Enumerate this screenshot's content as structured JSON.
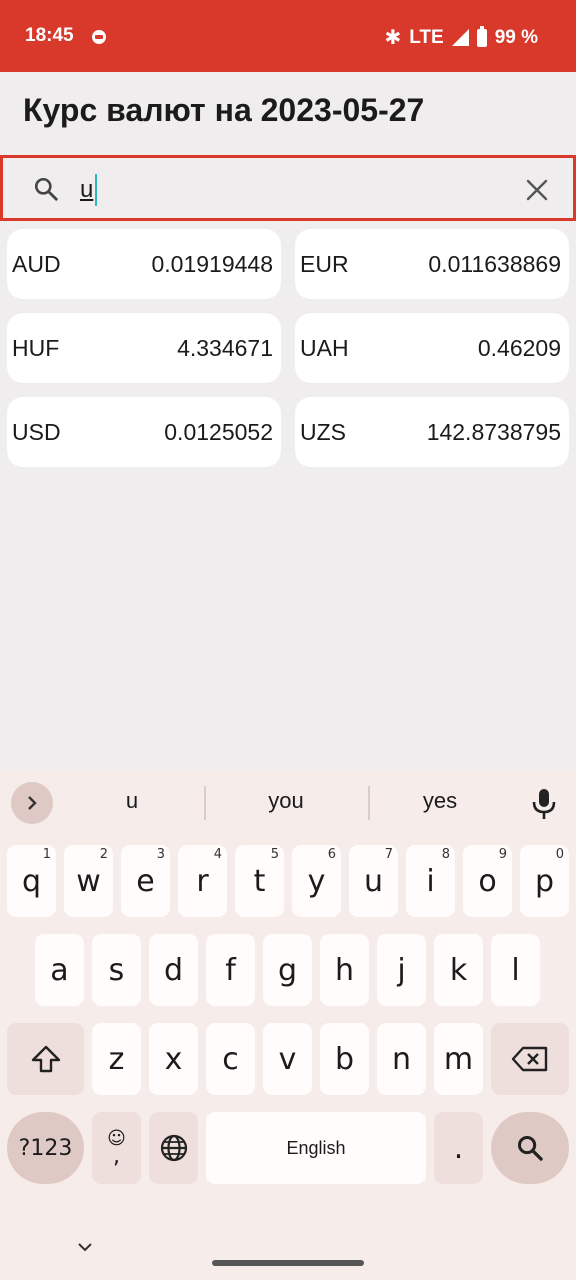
{
  "status_bar": {
    "time": "18:45",
    "network": "LTE",
    "battery": "99 %",
    "icons": [
      "app-icon",
      "bluetooth-icon",
      "signal-icon",
      "battery-icon"
    ]
  },
  "page": {
    "title": "Курс валют на 2023-05-27"
  },
  "search": {
    "value": "u"
  },
  "rates": [
    {
      "code": "AUD",
      "value": "0.01919448"
    },
    {
      "code": "EUR",
      "value": "0.011638869"
    },
    {
      "code": "HUF",
      "value": "4.334671"
    },
    {
      "code": "UAH",
      "value": "0.46209"
    },
    {
      "code": "USD",
      "value": "0.0125052"
    },
    {
      "code": "UZS",
      "value": "142.8738795"
    }
  ],
  "keyboard": {
    "suggestions": [
      "u",
      "you",
      "yes"
    ],
    "row1": [
      {
        "label": "q",
        "num": "1"
      },
      {
        "label": "w",
        "num": "2"
      },
      {
        "label": "e",
        "num": "3"
      },
      {
        "label": "r",
        "num": "4"
      },
      {
        "label": "t",
        "num": "5"
      },
      {
        "label": "y",
        "num": "6"
      },
      {
        "label": "u",
        "num": "7"
      },
      {
        "label": "i",
        "num": "8"
      },
      {
        "label": "o",
        "num": "9"
      },
      {
        "label": "p",
        "num": "0"
      }
    ],
    "row2": [
      "a",
      "s",
      "d",
      "f",
      "g",
      "h",
      "j",
      "k",
      "l"
    ],
    "row3": [
      "z",
      "x",
      "c",
      "v",
      "b",
      "n",
      "m"
    ],
    "symbols_label": "?123",
    "emoji_comma_label": ",",
    "space_label": "English",
    "period_label": "."
  },
  "colors": {
    "accent": "#d8392b",
    "background": "#efedee",
    "card": "#ffffff",
    "keyboard_bg": "#f6ecea"
  }
}
